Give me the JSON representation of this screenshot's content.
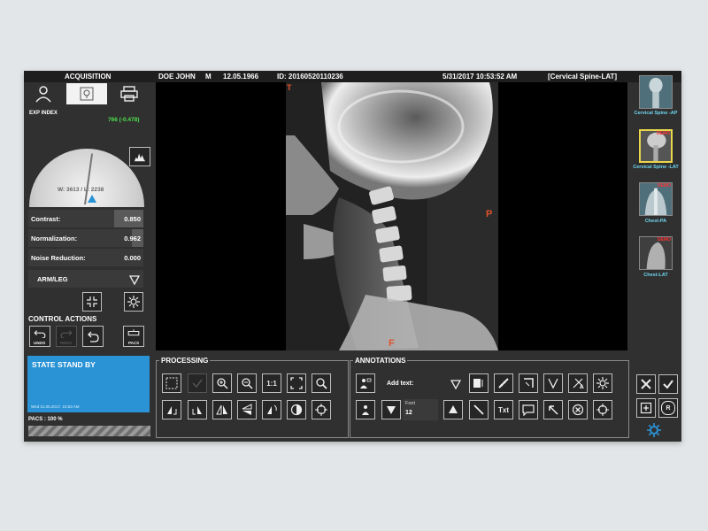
{
  "left_panel": {
    "title": "ACQUISITION",
    "exp_index_label": "EXP INDEX",
    "exp_index_value": "766 (-0.478)",
    "window_level": "W: 3613 / L: 2238",
    "sliders": [
      {
        "label": "Contrast:",
        "value": "0.850",
        "level": 0.25
      },
      {
        "label": "Normalization:",
        "value": "0.962",
        "level": 0.1
      },
      {
        "label": "Noise Reduction:",
        "value": "0.000",
        "level": 0.0
      }
    ],
    "preset_value": "ARM/LEG",
    "control_actions_title": "CONTROL ACTIONS",
    "undo_label": "UNDO",
    "redo_label": "REDO",
    "pacs_label": "PACS"
  },
  "patient_bar": {
    "name": "DOE JOHN",
    "sex": "M",
    "dob": "12.05.1966",
    "id": "ID: 20160520110236",
    "datetime": "5/31/2017 10:53:52 AM",
    "exam": "[Cervical Spine-LAT]"
  },
  "image_markers": {
    "top": "T",
    "right": "P",
    "bottom": "F"
  },
  "thumbnails": [
    {
      "caption": "Cervical Spine -AP",
      "badge": ""
    },
    {
      "caption": "Cervical Spine -LAT",
      "badge": "DEMO",
      "selected": true
    },
    {
      "caption": "Chest-PA",
      "badge": "DEMO"
    },
    {
      "caption": "Chest-LAT",
      "badge": "DEMO"
    }
  ],
  "status": {
    "state": "STATE STAND BY",
    "timestamp": "Wed 31.05.2017. 10:53 AM",
    "pacs": "PACS : 100 %"
  },
  "processing": {
    "title": "PROCESSING",
    "ratio_label": "1:1"
  },
  "annotations": {
    "title": "ANNOTATIONS",
    "add_text_label": "Add text:",
    "font_label": "Font",
    "font_size": "12",
    "txt_label": "Txt"
  },
  "actions": {
    "r_label": "R"
  },
  "colors": {
    "accent_blue": "#2a93d5",
    "thumb_caption": "#6fd6ef",
    "exp_index_green": "#4ee04e",
    "selected_border": "#e9d64a",
    "marker_orange": "#e0522a"
  }
}
